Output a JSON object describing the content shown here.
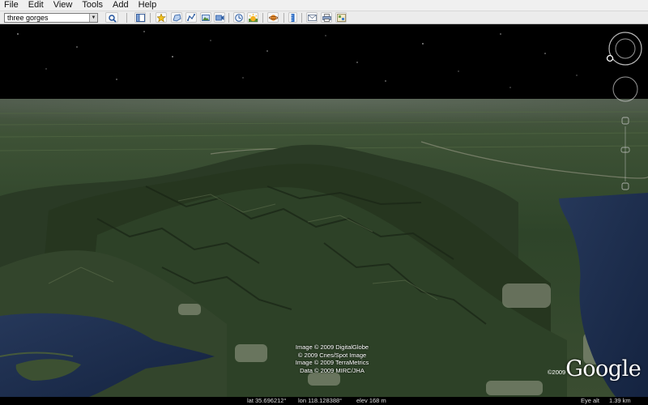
{
  "menu": {
    "items": [
      "File",
      "Edit",
      "View",
      "Tools",
      "Add",
      "Help"
    ]
  },
  "search": {
    "value": "three gorges",
    "search_icon": "magnifier-icon"
  },
  "toolbar": {
    "icons": [
      "sidebar-toggle-icon",
      "placemark-icon",
      "polygon-icon",
      "path-icon",
      "image-overlay-icon",
      "record-tour-icon",
      "historical-imagery-icon",
      "sunlight-icon",
      "switch-to-sky-icon",
      "ruler-icon",
      "email-icon",
      "print-icon",
      "view-in-google-maps-icon"
    ]
  },
  "attribution": {
    "lines": [
      "Image © 2009 DigitalGlobe",
      "© 2009 Cnes/Spot Image",
      "Image © 2009 TerraMetrics",
      "Data © 2009 MIRC/JHA"
    ]
  },
  "logo": {
    "copyright": "©2009",
    "text": "Google"
  },
  "status": {
    "lat": "lat  35.696212°",
    "lon": "lon  118.128388°",
    "elev": "elev  168 m",
    "eye_alt": "Eye alt",
    "eye_alt_value": "1.39 km"
  },
  "colors": {
    "sky": "#000000",
    "terrain": "#2f3f2a",
    "water": "#1b2a45",
    "toolbar": "#ececec"
  }
}
